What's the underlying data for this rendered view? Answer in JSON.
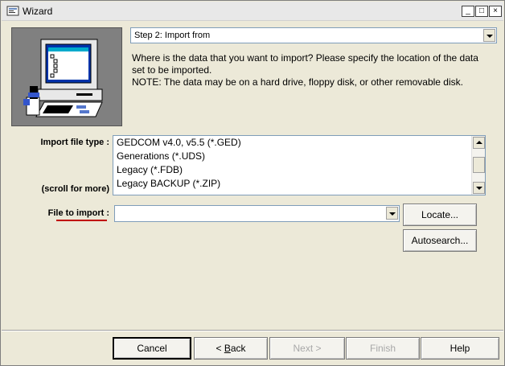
{
  "window": {
    "title": "Wizard",
    "minimize_glyph": "_",
    "maximize_glyph": "□",
    "close_glyph": "×"
  },
  "step": {
    "selected": "Step 2: Import from"
  },
  "instructions": {
    "line1": "Where is the data that you want to import? Please specify the location of the data set to be imported.",
    "line2": "NOTE: The data may be on a hard drive, floppy disk, or other removable disk."
  },
  "import_type": {
    "label": "Import file type :",
    "hint": "(scroll for more)",
    "items": [
      "GEDCOM v4.0, v5.5 (*.GED)",
      "Generations (*.UDS)",
      "Legacy (*.FDB)",
      "Legacy BACKUP (*.ZIP)"
    ]
  },
  "file_to_import": {
    "label": "File to import :",
    "value": ""
  },
  "buttons": {
    "locate": "Locate...",
    "autosearch": "Autosearch...",
    "cancel": "Cancel",
    "back_prefix": "< ",
    "back_hotkey": "B",
    "back_rest": "ack",
    "next": "Next >",
    "finish": "Finish",
    "help": "Help"
  },
  "colors": {
    "window_bg": "#ece9d8",
    "disabled_text": "#a8a8a8",
    "label_underline": "#c00000"
  }
}
